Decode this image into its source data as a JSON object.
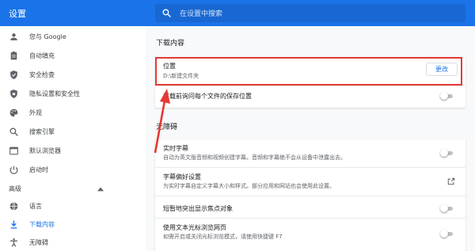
{
  "app": {
    "title": "设置"
  },
  "search": {
    "placeholder": "在设置中搜索"
  },
  "sidebar": {
    "items": [
      {
        "label": "您与 Google",
        "icon": "person-icon"
      },
      {
        "label": "自动填充",
        "icon": "clipboard-icon"
      },
      {
        "label": "安全检查",
        "icon": "shield-check-icon"
      },
      {
        "label": "隐私设置和安全性",
        "icon": "shield-lock-icon"
      },
      {
        "label": "外观",
        "icon": "palette-icon"
      },
      {
        "label": "搜索引擎",
        "icon": "search-icon"
      },
      {
        "label": "默认浏览器",
        "icon": "browser-icon"
      },
      {
        "label": "启动时",
        "icon": "power-icon"
      }
    ],
    "advanced_label": "高级",
    "advanced_items": [
      {
        "label": "语言",
        "icon": "globe-icon"
      },
      {
        "label": "下载内容",
        "icon": "download-icon",
        "active": true
      },
      {
        "label": "无障碍",
        "icon": "accessibility-icon"
      }
    ]
  },
  "downloads": {
    "section_title": "下载内容",
    "location": {
      "title": "位置",
      "path": "D:\\新建文件夹",
      "button": "更改"
    },
    "ask": {
      "title": "下载前询问每个文件的保存位置",
      "enabled": false
    }
  },
  "accessibility": {
    "section_title": "无障碍",
    "rows": [
      {
        "title": "实时字幕",
        "subtitle": "自动为英文版音频和视频创建字幕。音频和字幕绝不会从设备中泄露出去。",
        "control": "toggle",
        "enabled": false
      },
      {
        "title": "字幕偏好设置",
        "subtitle": "为实时字幕自定义字幕大小和样式。部分应用和网站也会使用此设置。",
        "control": "external-link",
        "enabled": null
      },
      {
        "title": "短暂地突出显示焦点对象",
        "subtitle": "",
        "control": "toggle",
        "enabled": false
      },
      {
        "title": "使用文本光标浏览网页",
        "subtitle": "如需开启或关闭光标浏览模式，请使用快捷键 F7",
        "control": "toggle",
        "enabled": false
      }
    ]
  },
  "colors": {
    "brand": "#1a73e8",
    "highlight": "#e53935"
  }
}
